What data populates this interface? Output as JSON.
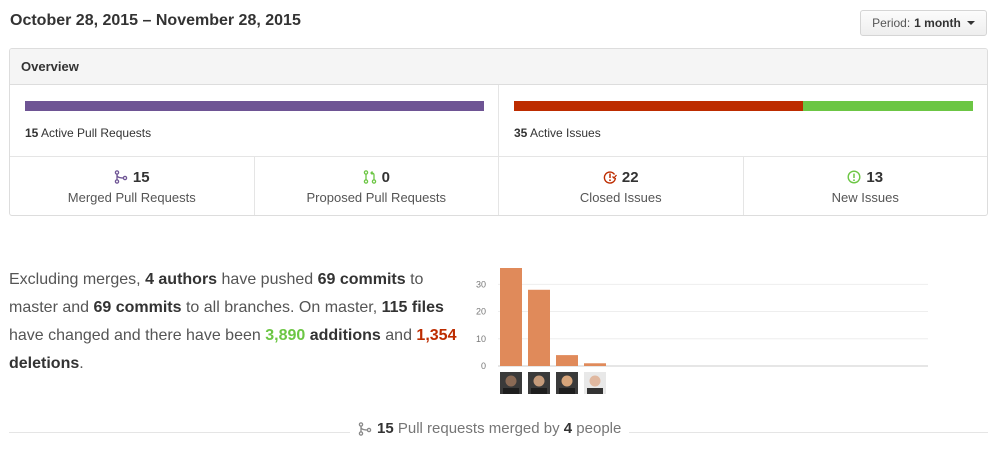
{
  "header": {
    "date_range": "October 28, 2015 – November 28, 2015",
    "period_label": "Period:",
    "period_value": "1 month"
  },
  "overview": {
    "title": "Overview",
    "pull_requests": {
      "count": "15",
      "caption": "Active Pull Requests",
      "bar_color": "#6e5494"
    },
    "issues": {
      "count": "35",
      "caption": "Active Issues",
      "closed_fraction": 0.629,
      "closed_color": "#bd2c00",
      "new_color": "#6cc644"
    },
    "stats": [
      {
        "value": "15",
        "label": "Merged Pull Requests",
        "icon": "git-merge-icon",
        "color": "#6e5494"
      },
      {
        "value": "0",
        "label": "Proposed Pull Requests",
        "icon": "git-pull-request-icon",
        "color": "#6cc644"
      },
      {
        "value": "22",
        "label": "Closed Issues",
        "icon": "issue-closed-icon",
        "color": "#bd2c00"
      },
      {
        "value": "13",
        "label": "New Issues",
        "icon": "issue-opened-icon",
        "color": "#6cc644"
      }
    ]
  },
  "summary": {
    "t1": "Excluding merges, ",
    "authors": "4 authors",
    "t2": " have pushed ",
    "commits_master": "69 commits",
    "t3": " to master and ",
    "commits_all": "69 commits",
    "t4": " to all branches. On master, ",
    "files": "115 files",
    "t5": " have changed and there have been ",
    "additions_num": "3,890",
    "additions_word": " additions",
    "t6": " and ",
    "deletions_num": "1,354",
    "deletions_word": " deletions",
    "t7": "."
  },
  "chart_data": {
    "type": "bar",
    "categories": [
      "author-1",
      "author-2",
      "author-3",
      "author-4"
    ],
    "values": [
      36,
      28,
      4,
      1
    ],
    "ylim": [
      0,
      36
    ],
    "yticks": [
      "0",
      "10",
      "20",
      "30"
    ],
    "bar_color": "#e08a5a",
    "grid": true
  },
  "footer": {
    "count": "15",
    "text1": " Pull requests merged by ",
    "people_count": "4",
    "text2": " people"
  }
}
